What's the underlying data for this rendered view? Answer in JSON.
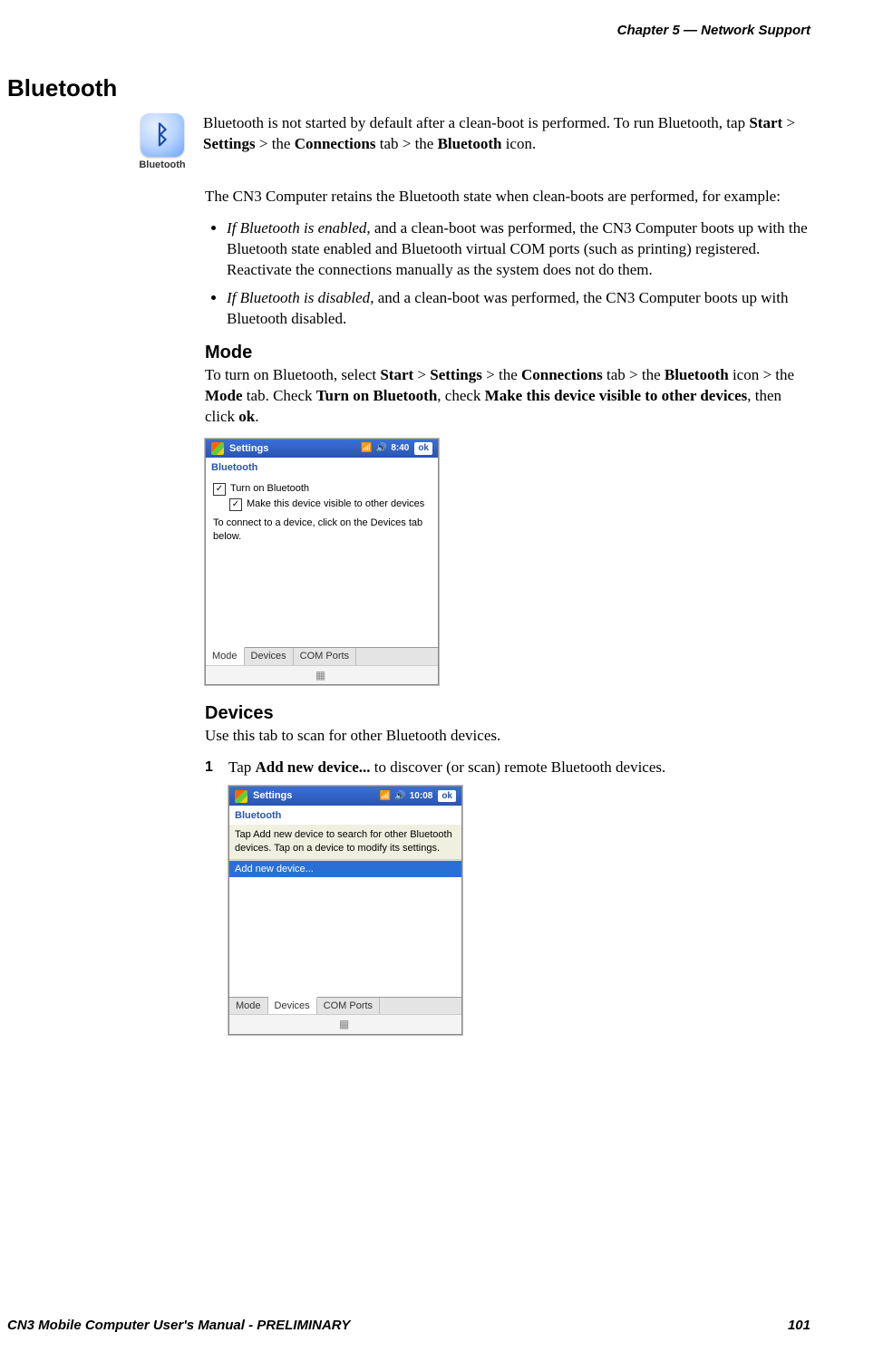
{
  "header": {
    "chapter": "Chapter 5 —  Network Support"
  },
  "section": {
    "title": "Bluetooth"
  },
  "bt_icon": {
    "glyph": "ᛒ",
    "label": "Bluetooth"
  },
  "intro": {
    "p1_pre": "Bluetooth is not started by default after a clean-boot is performed. To run Bluetooth, tap ",
    "start": "Start",
    "gt1": " > ",
    "settings": "Settings",
    "gt2": " > the ",
    "connections": "Connections",
    "tab_gt": " tab > the ",
    "bluetooth": "Bluetooth",
    "p1_post": " icon."
  },
  "para2": "The CN3 Computer retains the Bluetooth state when clean-boots are performed, for example:",
  "bullets": {
    "b1_em": "If Bluetooth is enabled",
    "b1_rest": ", and a clean-boot was performed, the CN3 Computer boots up with the Bluetooth state enabled and Bluetooth virtual COM ports (such as printing) registered. Reactivate the connections manually as the system does not do them.",
    "b2_em": "If Bluetooth is disabled",
    "b2_rest": ", and a clean-boot was performed, the CN3 Computer boots up with Bluetooth disabled."
  },
  "mode": {
    "heading": "Mode",
    "p_pre": "To turn on Bluetooth, select ",
    "start": "Start",
    "gt1": " > ",
    "settings": "Settings",
    "gt2": " > the ",
    "connections": "Connections",
    "tab_gt": " tab > the ",
    "bluetooth": "Bluetooth",
    "icon_gt": " icon > the ",
    "mode_tab": "Mode",
    "p_mid": " tab. Check ",
    "turn_on": "Turn on Bluetooth",
    "p_mid2": ", check ",
    "make_vis": "Make this device visible to other devices",
    "p_mid3": ", then click ",
    "ok": "ok",
    "p_end": "."
  },
  "shot1": {
    "title": "Settings",
    "time": "8:40",
    "ok": "ok",
    "subtitle": "Bluetooth",
    "chk1": "Turn on Bluetooth",
    "chk2": "Make this device visible to other devices",
    "note": "To connect to a device, click on the Devices tab below.",
    "tabs": {
      "t1": "Mode",
      "t2": "Devices",
      "t3": "COM Ports"
    },
    "kbd": "▦"
  },
  "devices": {
    "heading": "Devices",
    "p1": "Use this tab to scan for other Bluetooth devices.",
    "step_num": "1",
    "step_pre": "Tap ",
    "step_bold": "Add new device...",
    "step_post": " to discover (or scan) remote Bluetooth devices."
  },
  "shot2": {
    "title": "Settings",
    "time": "10:08",
    "ok": "ok",
    "subtitle": "Bluetooth",
    "help": "Tap Add new device to search for other Bluetooth devices. Tap on a device to modify its settings.",
    "item": "Add new device...",
    "tabs": {
      "t1": "Mode",
      "t2": "Devices",
      "t3": "COM Ports"
    },
    "kbd": "▦"
  },
  "footer": {
    "left": "CN3 Mobile Computer User's Manual - PRELIMINARY",
    "right": "101"
  }
}
